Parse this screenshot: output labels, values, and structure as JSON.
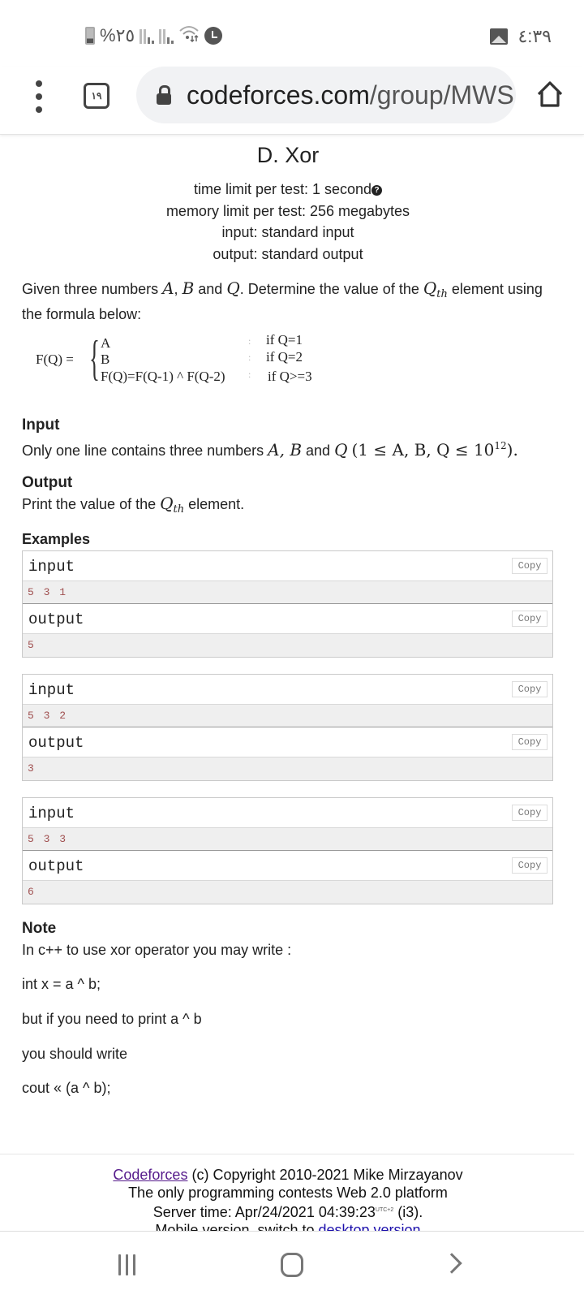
{
  "status_bar": {
    "battery_percent": "%٢٥",
    "time": "٤:٣٩",
    "icons": [
      "battery-icon",
      "signal-icon",
      "signal-icon",
      "wifi-icon",
      "alarm-icon",
      "gallery-icon"
    ]
  },
  "browser": {
    "tab_count": "١٩",
    "url_host": "codeforces.com",
    "url_path": "/group/MWS",
    "icons": [
      "menu-dots-icon",
      "tabs-icon",
      "lock-icon",
      "home-icon"
    ]
  },
  "problem": {
    "title": "D. Xor",
    "time_limit": "time limit per test: 1 second",
    "memory_limit": "memory limit per test: 256 megabytes",
    "input": "input: standard input",
    "output": "output: standard output",
    "statement_pre": "Given three numbers ",
    "statement_A": "A",
    "statement_comma": ", ",
    "statement_B": "B",
    "statement_and": " and ",
    "statement_Q": "Q",
    "statement_mid": ". Determine the value of the ",
    "statement_Qth_base": "Q",
    "statement_Qth_sub": "th",
    "statement_post": " element using the formula below:",
    "formula": {
      "lhs": "F(Q)  =",
      "cases": [
        {
          "expr": "A",
          "cond": "if Q=1"
        },
        {
          "expr": "B",
          "cond": "if Q=2"
        },
        {
          "expr": "F(Q)=F(Q-1) ^ F(Q-2)",
          "cond": "if Q>=3"
        }
      ]
    },
    "input_heading": "Input",
    "input_text_pre": "Only one line contains three numbers ",
    "input_math_vars": "A, B",
    "input_and": " and ",
    "input_math_q": "Q",
    "input_math_constraint": "(1 ≤ A, B, Q ≤ 10",
    "input_math_exp": "12",
    "input_math_close": ").",
    "output_heading": "Output",
    "output_text_pre": "Print the value of the ",
    "output_text_post": " element.",
    "examples_heading": "Examples",
    "examples": [
      {
        "input_label": "input",
        "input": "5 3 1",
        "output_label": "output",
        "output": "5",
        "copy": "Copy"
      },
      {
        "input_label": "input",
        "input": "5 3 2",
        "output_label": "output",
        "output": "3",
        "copy": "Copy"
      },
      {
        "input_label": "input",
        "input": "5 3 3",
        "output_label": "output",
        "output": "6",
        "copy": "Copy"
      }
    ],
    "note_heading": "Note",
    "note_lines": [
      "In c++ to use xor operator you may write :",
      "int x = a ^ b;",
      "but if you need to print a ^ b",
      "you should write",
      "cout « (a ^ b);"
    ]
  },
  "footer": {
    "codeforces_link": "Codeforces",
    "copyright": " (c) Copyright 2010-2021 Mike Mirzayanov",
    "tagline": "The only programming contests Web 2.0 platform",
    "server_time_label": "Server time: Apr/24/2021 04:39:23",
    "utc": "UTC+2",
    "server_suffix": " (i3).",
    "mobile_text": "Mobile version, switch to ",
    "desktop_link": "desktop version"
  },
  "navbar": {
    "icons": [
      "recent-apps-icon",
      "home-button-icon",
      "back-icon"
    ]
  }
}
